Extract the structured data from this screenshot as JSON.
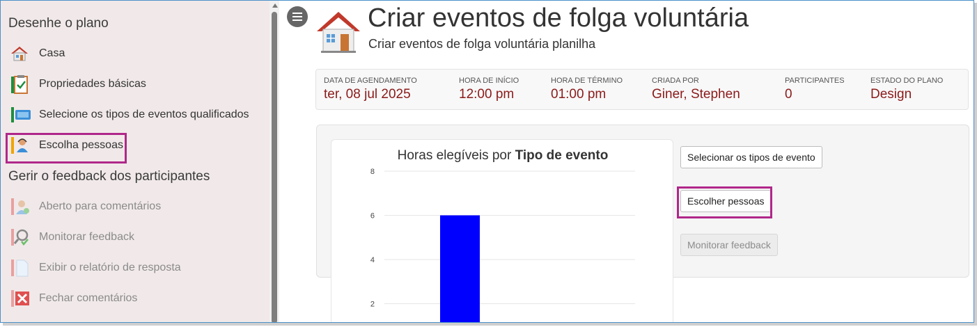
{
  "sidebar": {
    "section1_title": "Desenhe o plano",
    "section2_title": "Gerir o feedback dos participantes",
    "items": [
      {
        "label": "Casa",
        "icon": "house-icon"
      },
      {
        "label": "Propriedades básicas",
        "icon": "clipboard-icon"
      },
      {
        "label": "Selecione os tipos de eventos qualificados",
        "icon": "event-card-icon"
      },
      {
        "label": "Escolha pessoas",
        "icon": "person-icon"
      },
      {
        "label": "Aberto para comentários",
        "icon": "person-comment-icon"
      },
      {
        "label": "Monitorar feedback",
        "icon": "magnifier-icon"
      },
      {
        "label": "Exibir o relatório de resposta",
        "icon": "document-icon"
      },
      {
        "label": "Fechar comentários",
        "icon": "close-box-icon"
      }
    ]
  },
  "header": {
    "title": "Criar eventos de folga voluntária",
    "subtitle": "Criar eventos de folga voluntária planilha"
  },
  "info": [
    {
      "label": "Data de agendamento",
      "value": "ter, 08 jul 2025"
    },
    {
      "label": "Hora de início",
      "value": "12:00 pm"
    },
    {
      "label": "Hora de término",
      "value": "01:00 pm"
    },
    {
      "label": "Criada por",
      "value": "Giner, Stephen"
    },
    {
      "label": "Participantes",
      "value": "0"
    },
    {
      "label": "Estado do plano",
      "value": "Design"
    }
  ],
  "buttons": {
    "select_types": "Selecionar os tipos de evento",
    "choose_people": "Escolher pessoas",
    "monitor_feedback": "Monitorar feedback"
  },
  "chart_data": {
    "type": "bar",
    "title_prefix": "Horas elegíveis por ",
    "title_bold": "Tipo de evento",
    "categories": [
      ""
    ],
    "values": [
      6
    ],
    "yticks": [
      8,
      6,
      4,
      2
    ],
    "ylim": [
      0,
      8
    ],
    "grid": true,
    "bar_color": "#0000ff"
  },
  "colors": {
    "accent_value": "#8b1a1a",
    "highlight": "#b0278a",
    "sidebar_bg": "#f1e9e9"
  }
}
